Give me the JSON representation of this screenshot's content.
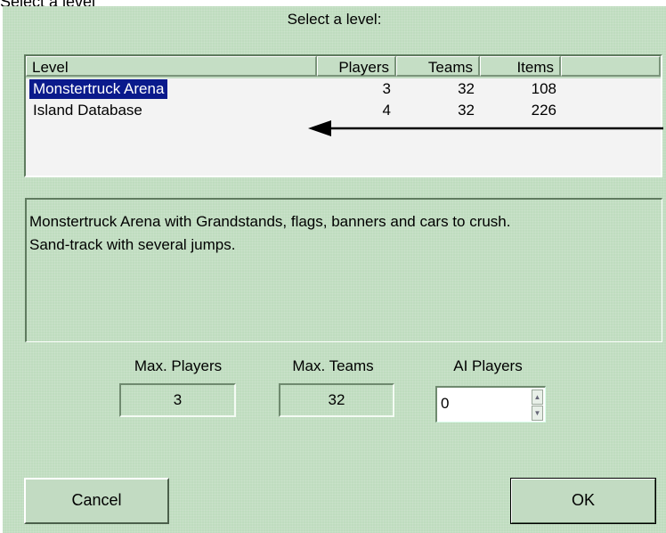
{
  "window": {
    "title": "Select a level"
  },
  "dialog": {
    "heading": "Select a level:",
    "list": {
      "columns": [
        "Level",
        "Players",
        "Teams",
        "Items"
      ],
      "rows": [
        {
          "name": "Monstertruck Arena",
          "players": "3",
          "teams": "32",
          "items": "108",
          "selected": true
        },
        {
          "name": "Island Database",
          "players": "4",
          "teams": "32",
          "items": "226",
          "selected": false
        }
      ]
    },
    "description": {
      "line1": "Monstertruck Arena with Grandstands, flags, banners and cars to crush.",
      "line2": "Sand-track with several jumps."
    },
    "stats": {
      "max_players_label": "Max. Players",
      "max_players_value": "3",
      "max_teams_label": "Max. Teams",
      "max_teams_value": "32",
      "ai_players_label": "AI Players",
      "ai_players_value": "0"
    },
    "buttons": {
      "cancel": "Cancel",
      "ok": "OK"
    },
    "colors": {
      "background": "#bfdcbf",
      "selection": "#0a1a8c",
      "list_bg": "#f3f3f3"
    }
  }
}
